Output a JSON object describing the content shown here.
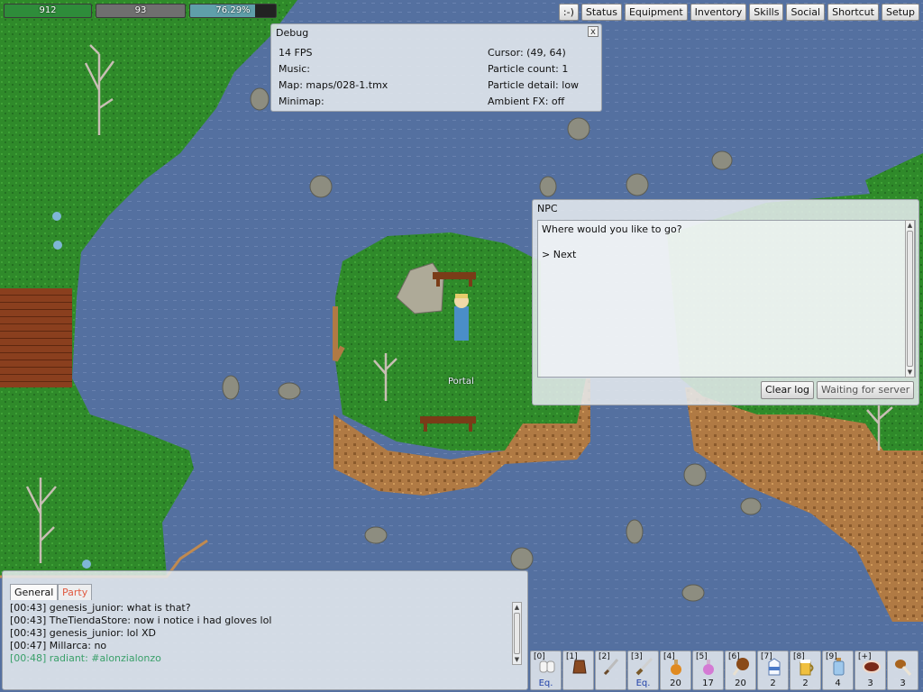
{
  "stats": {
    "hp": {
      "label": "912",
      "value": 1.0,
      "color": "#2e8c3a"
    },
    "mp": {
      "label": "93",
      "value": 1.0,
      "color": "#6f6f6f"
    },
    "xp": {
      "label": "76.29%",
      "value": 0.7629,
      "color": "#5f9fa9"
    }
  },
  "menu": {
    "items": [
      "Status",
      "Equipment",
      "Inventory",
      "Skills",
      "Social",
      "Shortcut",
      "Setup"
    ],
    "smiley": ":-)"
  },
  "debug": {
    "title": "Debug",
    "close": "x",
    "fps": "14 FPS",
    "music": "Music:",
    "map": "Map: maps/028-1.tmx",
    "minimap": "Minimap:",
    "cursor": "Cursor: (49, 64)",
    "particle_count": "Particle count: 1",
    "particle_detail": "Particle detail: low",
    "ambient": "Ambient FX: off"
  },
  "npc": {
    "title": "NPC",
    "question": "Where would you like to go?",
    "option": "> Next",
    "clear_log": "Clear log",
    "waiting": "Waiting for server"
  },
  "world": {
    "portal_label": "Portal"
  },
  "chat": {
    "tabs": {
      "general": "General",
      "party": "Party"
    },
    "lines": [
      {
        "text": "[00:43] genesis_junior: what is that?",
        "color": "#111111"
      },
      {
        "text": "[00:43] TheTiendaStore: now i notice i had gloves lol",
        "color": "#111111"
      },
      {
        "text": "[00:43] genesis_junior: lol XD",
        "color": "#111111"
      },
      {
        "text": "[00:47] Millarca: no",
        "color": "#111111"
      },
      {
        "text": "[00:48] radiant: #alonzialonzo",
        "color": "#3aa06a"
      }
    ]
  },
  "hotbar": {
    "slots": [
      {
        "key": "[0]",
        "qty": "Eq.",
        "icon": "gloves-icon"
      },
      {
        "key": "[1]",
        "qty": "",
        "icon": "leather-gloves-icon"
      },
      {
        "key": "[2]",
        "qty": "",
        "icon": "dagger-icon"
      },
      {
        "key": "[3]",
        "qty": "Eq.",
        "icon": "sword-icon"
      },
      {
        "key": "[4]",
        "qty": "20",
        "icon": "orange-potion-icon"
      },
      {
        "key": "[5]",
        "qty": "17",
        "icon": "pink-potion-icon"
      },
      {
        "key": "[6]",
        "qty": "20",
        "icon": "roast-chicken-icon"
      },
      {
        "key": "[7]",
        "qty": "2",
        "icon": "milk-carton-icon"
      },
      {
        "key": "[8]",
        "qty": "2",
        "icon": "beer-mug-icon"
      },
      {
        "key": "[9]",
        "qty": "4",
        "icon": "water-bottle-icon"
      },
      {
        "key": "[+]",
        "qty": "3",
        "icon": "steak-icon"
      },
      {
        "key": "",
        "qty": "3",
        "icon": "drumstick-icon"
      }
    ]
  }
}
